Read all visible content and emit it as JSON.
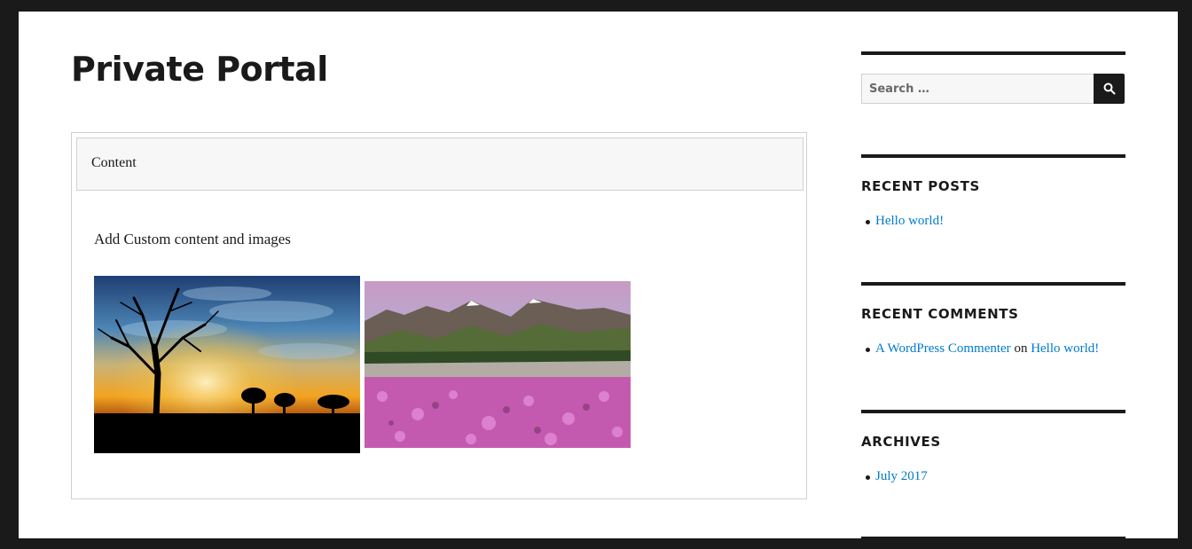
{
  "site": {
    "title": "Private Portal"
  },
  "content": {
    "header": "Content",
    "text": "Add Custom content and images",
    "images": [
      {
        "alt": "Sunset with tree silhouette"
      },
      {
        "alt": "Mountains with pink wildflower meadow"
      }
    ]
  },
  "search": {
    "placeholder": "Search …",
    "icon": "search-icon"
  },
  "recent_posts": {
    "title": "RECENT POSTS",
    "items": [
      "Hello world!"
    ]
  },
  "recent_comments": {
    "title": "RECENT COMMENTS",
    "author": "A WordPress Commenter",
    "connector": "on",
    "post": "Hello world!"
  },
  "archives": {
    "title": "ARCHIVES",
    "items": [
      "July 2017"
    ]
  },
  "colors": {
    "text": "#1a1a1a",
    "link": "#007acc",
    "frame": "#1a1a1a",
    "border": "#d1d1d1",
    "panel": "#f7f7f7"
  }
}
